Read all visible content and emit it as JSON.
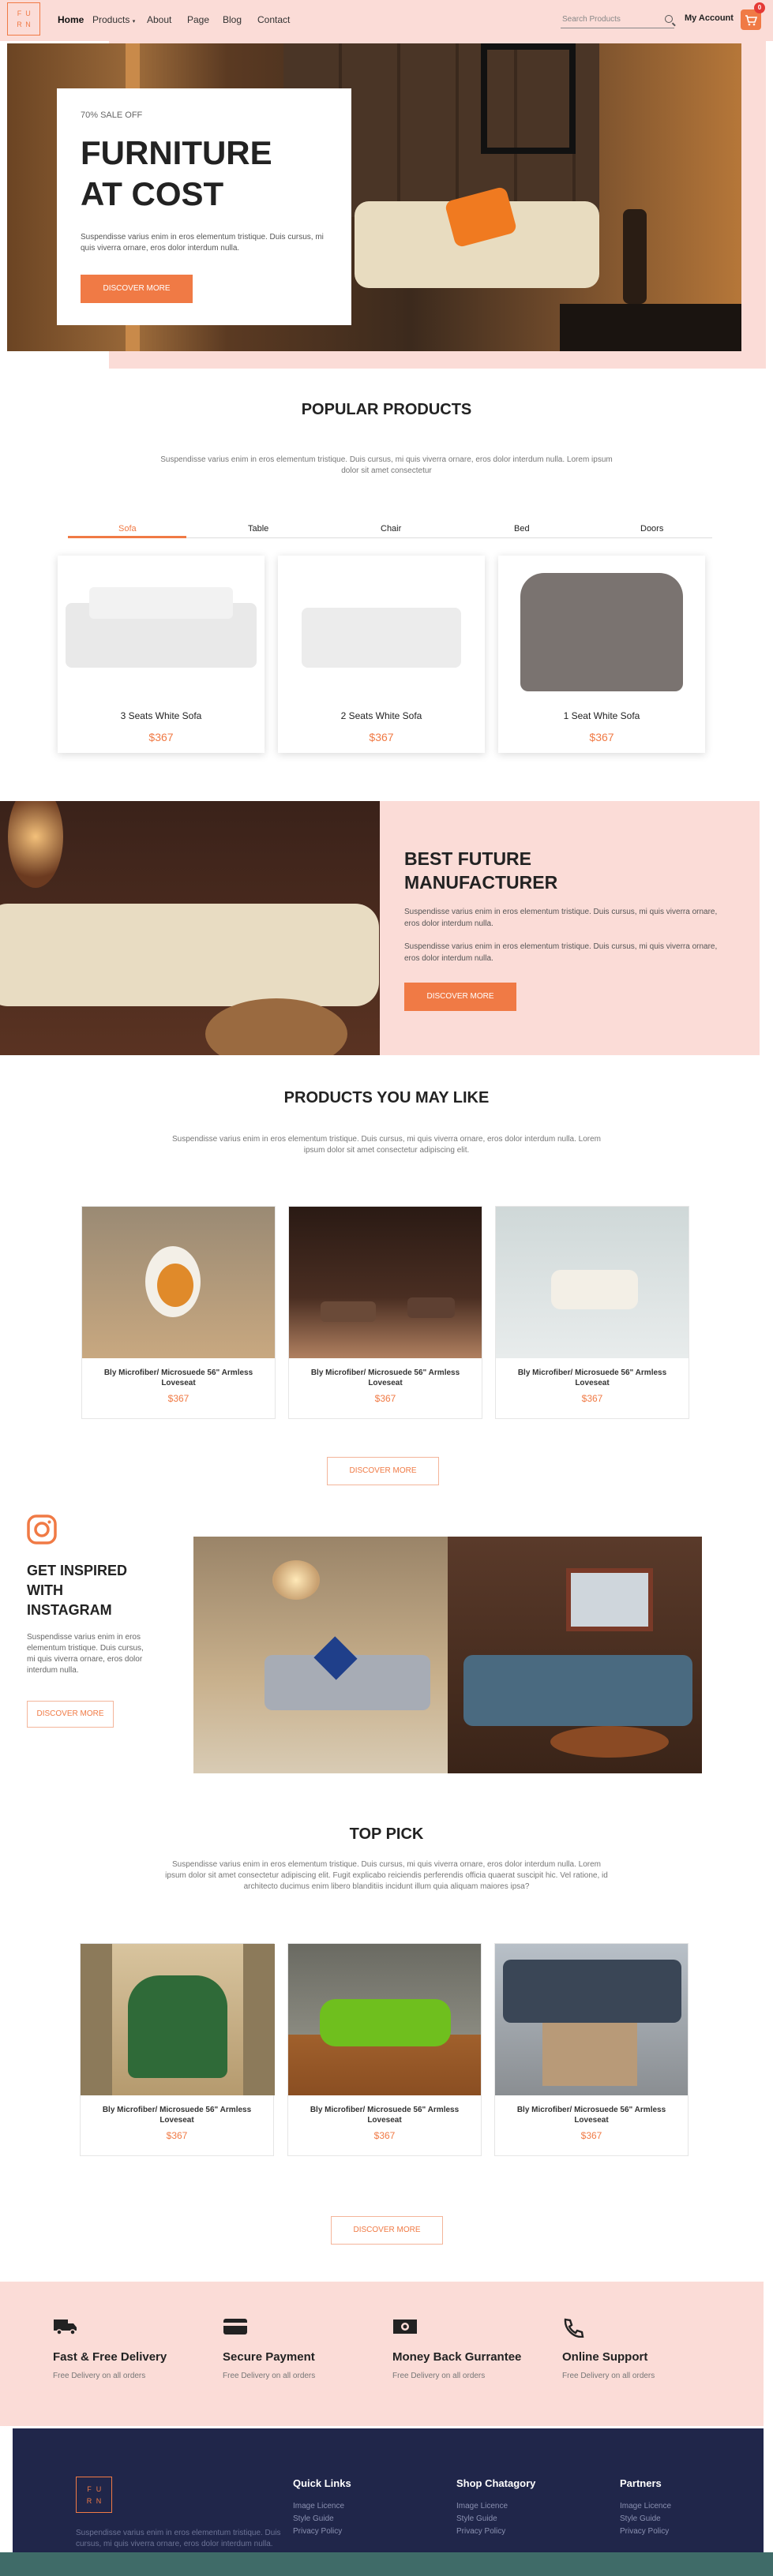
{
  "header": {
    "logo_letters": [
      "F",
      "U",
      "R",
      "N"
    ],
    "nav": [
      "Home",
      "Products",
      "About",
      "Page",
      "Blog",
      "Contact"
    ],
    "search_placeholder": "Search Products",
    "my_account": "My Account",
    "cart_count": "0"
  },
  "hero": {
    "kicker": "70% SALE OFF",
    "title_line1": "FURNITURE",
    "title_line2": "AT COST",
    "text": "Suspendisse varius enim in eros elementum tristique. Duis cursus, mi quis viverra ornare, eros dolor interdum nulla.",
    "button": "DISCOVER MORE"
  },
  "popular": {
    "title": "POPULAR PRODUCTS",
    "subtitle": "Suspendisse varius enim in eros elementum tristique. Duis cursus, mi quis viverra ornare, eros dolor interdum nulla. Lorem ipsum dolor sit amet consectetur",
    "tabs": [
      "Sofa",
      "Table",
      "Chair",
      "Bed",
      "Doors"
    ],
    "products": [
      {
        "name": "3 Seats White Sofa",
        "price": "$367"
      },
      {
        "name": "2 Seats White Sofa",
        "price": "$367"
      },
      {
        "name": "1 Seat White Sofa",
        "price": "$367"
      }
    ]
  },
  "manufacturer": {
    "title_line1": "BEST FUTURE",
    "title_line2": "MANUFACTURER",
    "p1": "Suspendisse varius enim in eros elementum tristique. Duis cursus, mi quis viverra ornare, eros dolor interdum nulla.",
    "p2": "Suspendisse varius enim in eros elementum tristique. Duis cursus, mi quis viverra ornare, eros dolor interdum nulla.",
    "button": "DISCOVER MORE"
  },
  "like": {
    "title": "PRODUCTS YOU MAY LIKE",
    "subtitle": "Suspendisse varius enim in eros elementum tristique. Duis cursus, mi quis viverra ornare, eros dolor interdum nulla. Lorem ipsum dolor sit amet consectetur adipiscing elit.",
    "items": [
      {
        "name": "Bly Microfiber/ Microsuede 56\" Armless Loveseat",
        "price": "$367"
      },
      {
        "name": "Bly Microfiber/ Microsuede 56\" Armless Loveseat",
        "price": "$367"
      },
      {
        "name": "Bly Microfiber/ Microsuede 56\" Armless Loveseat",
        "price": "$367"
      }
    ],
    "button": "DISCOVER MORE"
  },
  "instagram": {
    "title_line1": "GET INSPIRED",
    "title_line2": "WITH",
    "title_line3": "INSTAGRAM",
    "text": "Suspendisse varius enim in eros elementum tristique. Duis cursus, mi quis viverra ornare, eros dolor interdum nulla.",
    "button": "DISCOVER MORE"
  },
  "toppick": {
    "title": "TOP PICK",
    "subtitle": "Suspendisse varius enim in eros elementum tristique. Duis cursus, mi quis viverra ornare, eros dolor interdum nulla. Lorem ipsum dolor sit amet consectetur adipiscing elit. Fugit explicabo reiciendis perferendis officia quaerat suscipit hic. Vel ratione, id architecto ducimus enim libero blanditiis incidunt illum quia aliquam maiores ipsa?",
    "items": [
      {
        "name": "Bly Microfiber/ Microsuede 56\" Armless Loveseat",
        "price": "$367"
      },
      {
        "name": "Bly Microfiber/ Microsuede 56\" Armless Loveseat",
        "price": "$367"
      },
      {
        "name": "Bly Microfiber/ Microsuede 56\" Armless Loveseat",
        "price": "$367"
      }
    ],
    "button": "DISCOVER MORE"
  },
  "features": [
    {
      "title": "Fast & Free Delivery",
      "sub": "Free Delivery on all orders",
      "icon": "truck-icon"
    },
    {
      "title": "Secure Payment",
      "sub": "Free Delivery on all orders",
      "icon": "credit-card-icon"
    },
    {
      "title": "Money Back Gurrantee",
      "sub": "Free Delivery on all orders",
      "icon": "money-icon"
    },
    {
      "title": "Online Support",
      "sub": "Free Delivery on all orders",
      "icon": "phone-icon"
    }
  ],
  "footer": {
    "logo_letters": [
      "F",
      "U",
      "R",
      "N"
    ],
    "text": "Suspendisse varius enim in eros elementum tristique. Duis cursus, mi quis viverra ornare, eros dolor interdum nulla.",
    "columns": [
      {
        "title": "Quick Links",
        "links": [
          "Image Licence",
          "Style Guide",
          "Privacy Policy"
        ]
      },
      {
        "title": "Shop Chatagory",
        "links": [
          "Image Licence",
          "Style Guide",
          "Privacy Policy"
        ]
      },
      {
        "title": "Partners",
        "links": [
          "Image Licence",
          "Style Guide",
          "Privacy Policy"
        ]
      }
    ]
  },
  "colors": {
    "accent": "#f07a45",
    "pink": "#fbdcd7",
    "navy": "#20264a",
    "teal": "#3f6b68"
  }
}
